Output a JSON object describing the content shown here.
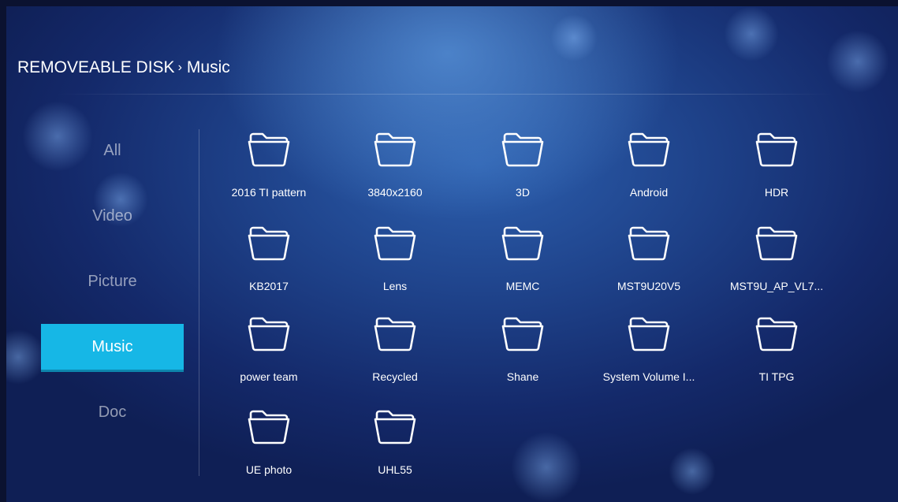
{
  "header": {
    "location": "REMOVEABLE DISK",
    "separator": "›",
    "current": "Music"
  },
  "categories": [
    {
      "label": "All",
      "active": false
    },
    {
      "label": "Video",
      "active": false
    },
    {
      "label": "Picture",
      "active": false
    },
    {
      "label": "Music",
      "active": true
    },
    {
      "label": "Doc",
      "active": false
    }
  ],
  "folders": [
    {
      "name": "2016 TI pattern"
    },
    {
      "name": "3840x2160"
    },
    {
      "name": "3D"
    },
    {
      "name": "Android"
    },
    {
      "name": "HDR"
    },
    {
      "name": "KB2017"
    },
    {
      "name": "Lens"
    },
    {
      "name": "MEMC"
    },
    {
      "name": "MST9U20V5"
    },
    {
      "name": "MST9U_AP_VL7..."
    },
    {
      "name": "power team"
    },
    {
      "name": "Recycled"
    },
    {
      "name": "Shane"
    },
    {
      "name": "System Volume I..."
    },
    {
      "name": "TI TPG"
    },
    {
      "name": "UE photo"
    },
    {
      "name": "UHL55"
    }
  ],
  "colors": {
    "accent": "#16b7e6",
    "background": "#1d3f86"
  },
  "icons": {
    "folder": "folder-icon"
  }
}
